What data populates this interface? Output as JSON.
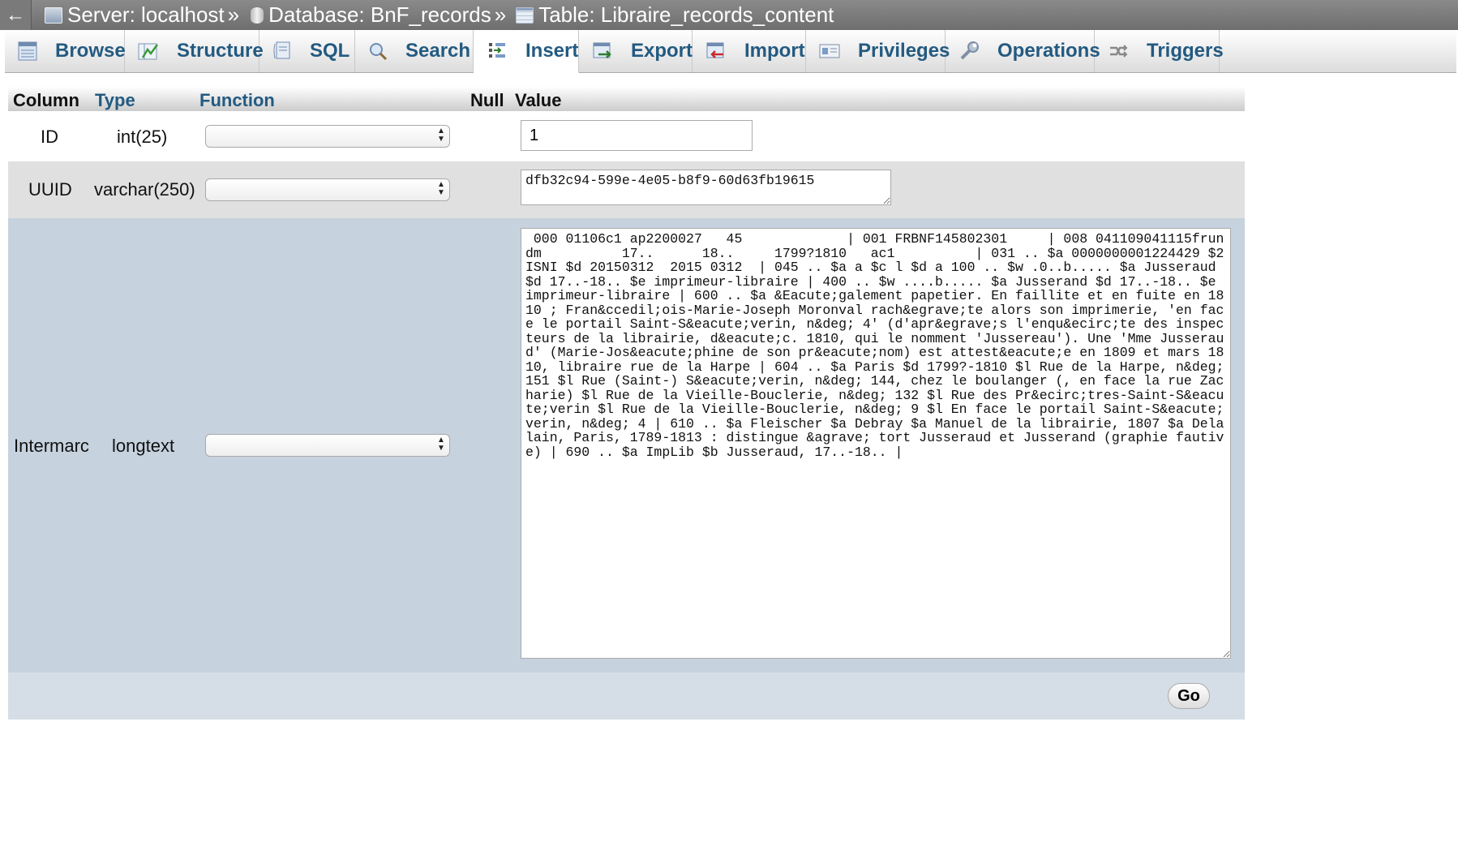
{
  "topbar": {
    "back_icon": "←",
    "server": "Server: localhost",
    "database": "Database: BnF_records",
    "table": "Table: Libraire_records_content",
    "separator": "»"
  },
  "tabs": [
    {
      "label": "Browse",
      "icon": "browse-icon"
    },
    {
      "label": "Structure",
      "icon": "structure-icon"
    },
    {
      "label": "SQL",
      "icon": "sql-icon"
    },
    {
      "label": "Search",
      "icon": "search-icon"
    },
    {
      "label": "Insert",
      "icon": "insert-icon",
      "active": true
    },
    {
      "label": "Export",
      "icon": "export-icon"
    },
    {
      "label": "Import",
      "icon": "import-icon"
    },
    {
      "label": "Privileges",
      "icon": "privileges-icon"
    },
    {
      "label": "Operations",
      "icon": "operations-icon"
    },
    {
      "label": "Triggers",
      "icon": "triggers-icon"
    }
  ],
  "headers": {
    "column": "Column",
    "type": "Type",
    "function": "Function",
    "null": "Null",
    "value": "Value"
  },
  "rows": [
    {
      "column": "ID",
      "type": "int(25)",
      "function": "",
      "value": "1"
    },
    {
      "column": "UUID",
      "type": "varchar(250)",
      "function": "",
      "value": "dfb32c94-599e-4e05-b8f9-60d63fb19615"
    },
    {
      "column": "Intermarc",
      "type": "longtext",
      "function": "",
      "value": " 000 01106c1 ap2200027   45             | 001 FRBNF145802301     | 008 041109041115frundm          17..      18..     1799?1810   ac1          | 031 .. $a 0000000001224429 $2 ISNI $d 20150312  2015 0312  | 045 .. $a a $c l $d a 100 .. $w .0..b..... $a Jusseraud $d 17..-18.. $e imprimeur-libraire | 400 .. $w ....b..... $a Jusserand $d 17..-18.. $e imprimeur-libraire | 600 .. $a &Eacute;galement papetier. En faillite et en fuite en 1810 ; Fran&ccedil;ois-Marie-Joseph Moronval rach&egrave;te alors son imprimerie, 'en face le portail Saint-S&eacute;verin, n&deg; 4' (d'apr&egrave;s l'enqu&ecirc;te des inspecteurs de la librairie, d&eacute;c. 1810, qui le nomment 'Jussereau'). Une 'Mme Jusseraud' (Marie-Jos&eacute;phine de son pr&eacute;nom) est attest&eacute;e en 1809 et mars 1810, libraire rue de la Harpe | 604 .. $a Paris $d 1799?-1810 $l Rue de la Harpe, n&deg; 151 $l Rue (Saint-) S&eacute;verin, n&deg; 144, chez le boulanger (, en face la rue Zacharie) $l Rue de la Vieille-Bouclerie, n&deg; 132 $l Rue des Pr&ecirc;tres-Saint-S&eacute;verin $l Rue de la Vieille-Bouclerie, n&deg; 9 $l En face le portail Saint-S&eacute;verin, n&deg; 4 | 610 .. $a Fleischer $a Debray $a Manuel de la librairie, 1807 $a Delalain, Paris, 1789-1813 : distingue &agrave; tort Jusseraud et Jusserand (graphie fautive) | 690 .. $a ImpLib $b Jusseraud, 17..-18.. |"
    }
  ],
  "go_label": "Go",
  "colors": {
    "row_alt": "#e0e0e0",
    "row_highlight": "#c6d2de",
    "footer": "#d5dde6",
    "tab_text": "#235a81"
  }
}
